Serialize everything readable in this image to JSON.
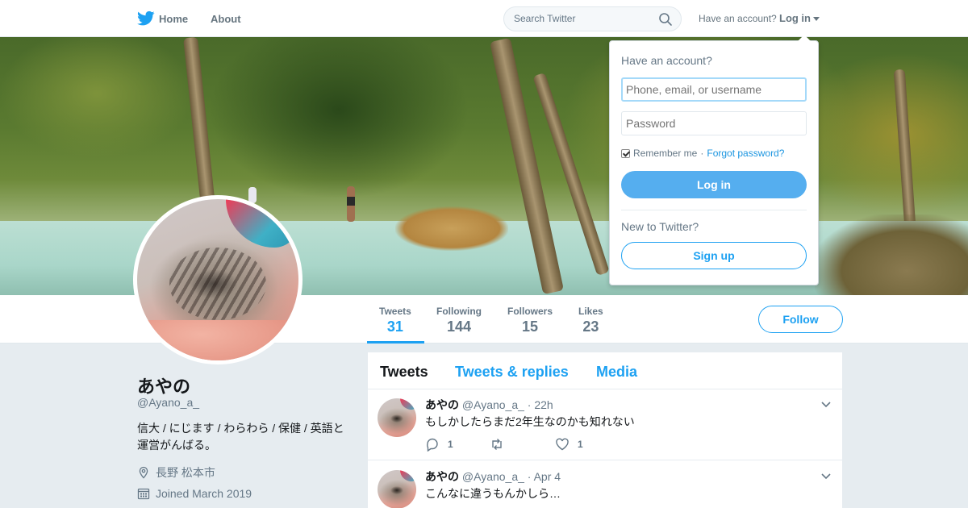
{
  "nav": {
    "home_label": "Home",
    "about_label": "About",
    "search_placeholder": "Search Twitter",
    "have_account_text": "Have an account?",
    "login_label": "Log in"
  },
  "profile": {
    "name": "あやの",
    "handle": "@Ayano_a_",
    "bio": "信大 / にじます / わらわら / 保健 / 英語と運営がんばる。",
    "location": "長野 松本市",
    "joined": "Joined March 2019",
    "follow_label": "Follow"
  },
  "stats": [
    {
      "label": "Tweets",
      "value": "31"
    },
    {
      "label": "Following",
      "value": "144"
    },
    {
      "label": "Followers",
      "value": "15"
    },
    {
      "label": "Likes",
      "value": "23"
    }
  ],
  "timeline": {
    "tabs": [
      "Tweets",
      "Tweets & replies",
      "Media"
    ],
    "tweets": [
      {
        "name": "あやの",
        "handle": "@Ayano_a_",
        "time": "· 22h",
        "text": "もしかしたらまだ2年生なのかも知れない",
        "replies": "1",
        "retweets": "",
        "likes": "1"
      },
      {
        "name": "あやの",
        "handle": "@Ayano_a_",
        "time": "· Apr 4",
        "text": "こんなに違うもんかしら…",
        "replies": "",
        "retweets": "",
        "likes": ""
      }
    ]
  },
  "login_dropdown": {
    "title": "Have an account?",
    "username_placeholder": "Phone, email, or username",
    "password_placeholder": "Password",
    "remember_label": "Remember me",
    "separator": " · ",
    "forgot_label": "Forgot password?",
    "login_button": "Log in",
    "new_text": "New to Twitter?",
    "signup_button": "Sign up"
  },
  "colors": {
    "accent": "#1da1f2",
    "login_button": "#55aeef",
    "page_background": "#e6ecf0"
  },
  "icons": [
    "twitter-bird-icon",
    "search-icon",
    "caret-down-icon",
    "location-icon",
    "calendar-icon",
    "reply-icon",
    "retweet-icon",
    "like-icon",
    "chevron-down-icon"
  ]
}
